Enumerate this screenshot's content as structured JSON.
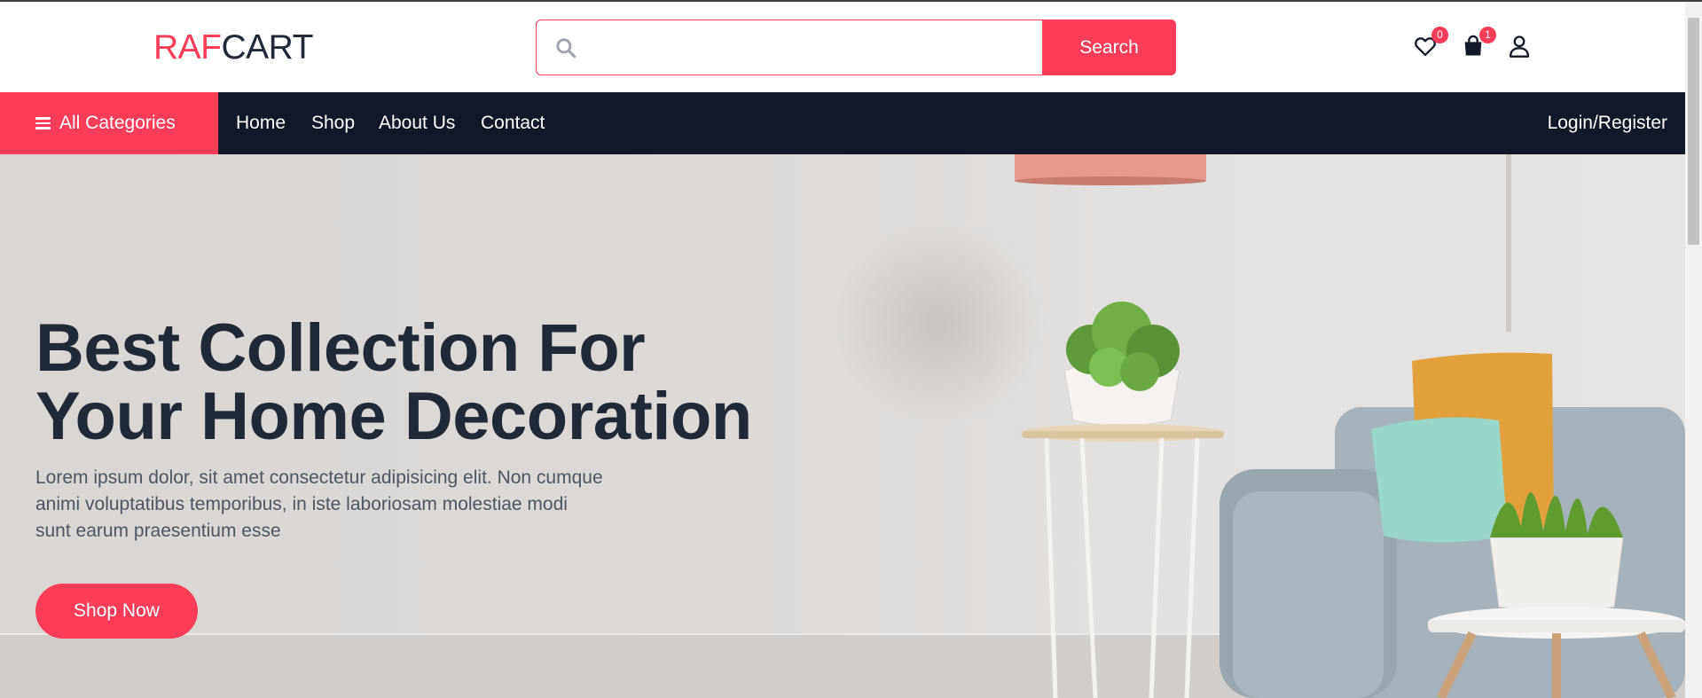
{
  "logo": {
    "part1": "RAF",
    "part2": "CART"
  },
  "search": {
    "placeholder": "",
    "value": "",
    "button_label": "Search"
  },
  "header_icons": {
    "wishlist": {
      "icon": "heart-icon",
      "count": "0"
    },
    "cart": {
      "icon": "shopping-bag-icon",
      "count": "1"
    },
    "account": {
      "icon": "user-icon"
    }
  },
  "nav": {
    "categories_label": "All Categories",
    "links": [
      {
        "label": "Home"
      },
      {
        "label": "Shop"
      },
      {
        "label": "About Us"
      },
      {
        "label": "Contact"
      }
    ],
    "login_label": "Login/Register"
  },
  "hero": {
    "title_line1": "Best Collection For",
    "title_line2": "Your Home Decoration",
    "description": "Lorem ipsum dolor, sit amet consectetur adipisicing elit. Non cumque animi voluptatibus temporibus, in iste laboriosam molestiae modi sunt earum praesentium esse",
    "cta_label": "Shop Now"
  },
  "colors": {
    "accent": "#fd3d57",
    "nav_bg": "#111827",
    "heading": "#1f2937"
  }
}
